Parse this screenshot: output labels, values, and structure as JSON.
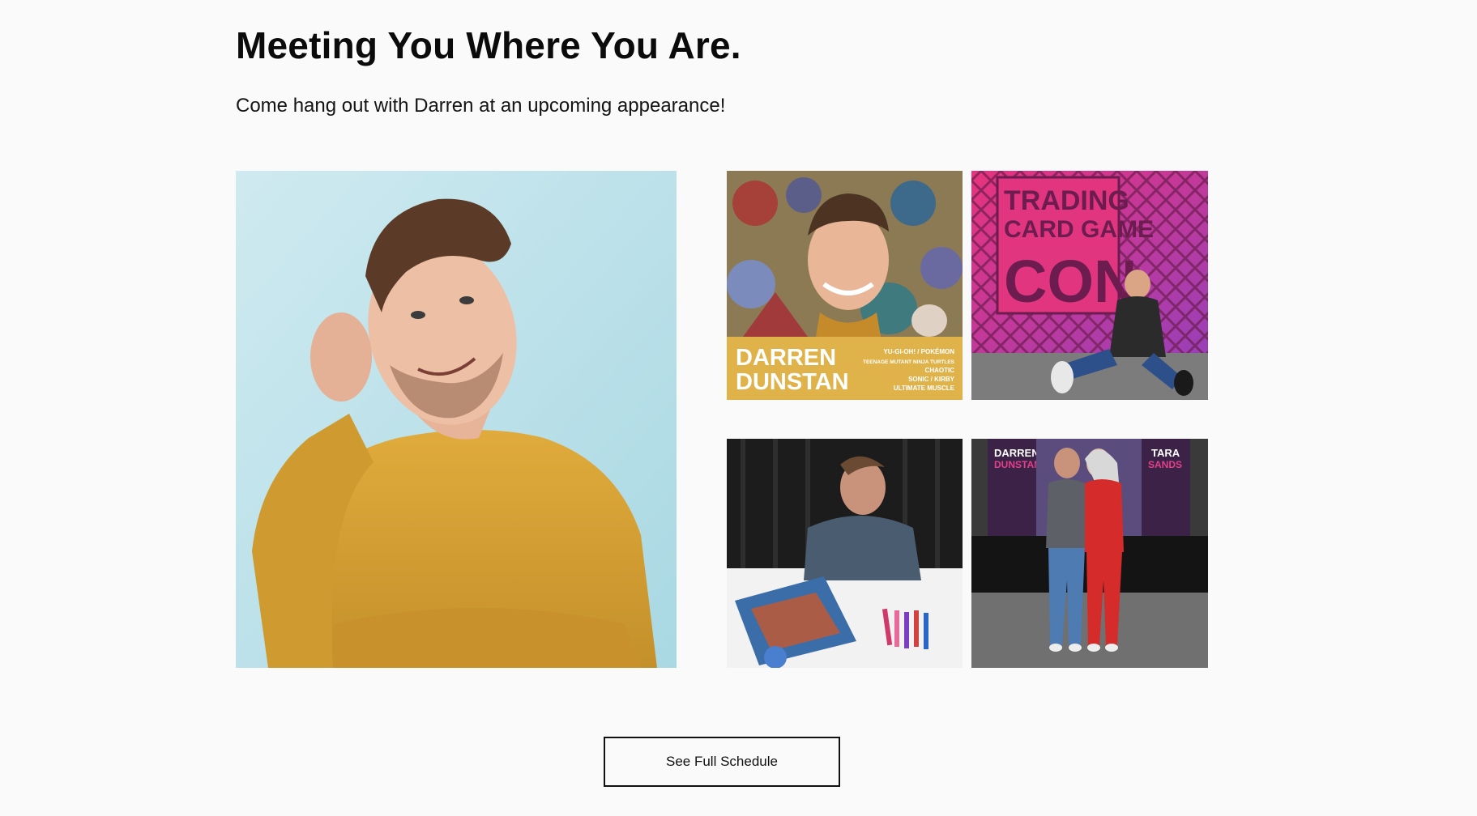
{
  "section": {
    "title": "Meeting You Where You Are.",
    "subtitle": "Come hang out with Darren at an upcoming appearance!"
  },
  "gallery": {
    "poster_name_line1": "DARREN",
    "poster_name_line2": "DUNSTAN",
    "poster_credits": [
      "YU-GI-OH! / POKÉMON",
      "TEENAGE MUTANT NINJA TURTLES",
      "CHAOTIC",
      "SONIC / KIRBY",
      "ULTIMATE MUSCLE"
    ],
    "con_banner_line1": "TRADING",
    "con_banner_line2": "CARD GAME",
    "con_banner_line3": "CON",
    "booth_sign_left_line1": "DARREN",
    "booth_sign_left_line2": "DUNSTAN",
    "booth_sign_right_line1": "TARA",
    "booth_sign_right_line2": "SANDS"
  },
  "cta": {
    "label": "See Full Schedule"
  },
  "colors": {
    "background": "#fafafa",
    "text": "#111111",
    "button_border": "#111111",
    "portrait_bg": "#c9e8ee",
    "sweater": "#d3a032",
    "poster_band": "#e0b24a",
    "con_banner": "#d6307a"
  }
}
